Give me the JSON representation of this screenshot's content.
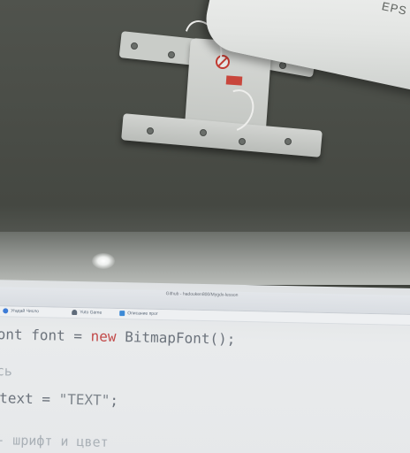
{
  "projector": {
    "brand": "EPS"
  },
  "browser": {
    "window_title": "Github - hadouken800/Mygdx-lesson",
    "bookmarks": [
      {
        "icon": "badge-icon",
        "label": "Угадай Число",
        "color": "#3d7bd6"
      },
      {
        "icon": "person-icon",
        "label": "Yuto Game",
        "color": "#5f6b7a"
      },
      {
        "icon": "bookmark-icon",
        "label": "Описание прог",
        "color": "#3d8ad6"
      }
    ]
  },
  "code": {
    "line1_prefix": "ont font = ",
    "line1_keyword": "new",
    "line1_suffix": " BitmapFont();",
    "line2_comment": "сь",
    "line3_prefix": "text = ",
    "line3_string": "\"TEXT\"",
    "line3_suffix": ";",
    "line4_comment": "- шрифт и цвет"
  },
  "colors": {
    "keyword": "#c24a4a",
    "code_text": "#6c737c",
    "comment": "#a9b0b6"
  }
}
